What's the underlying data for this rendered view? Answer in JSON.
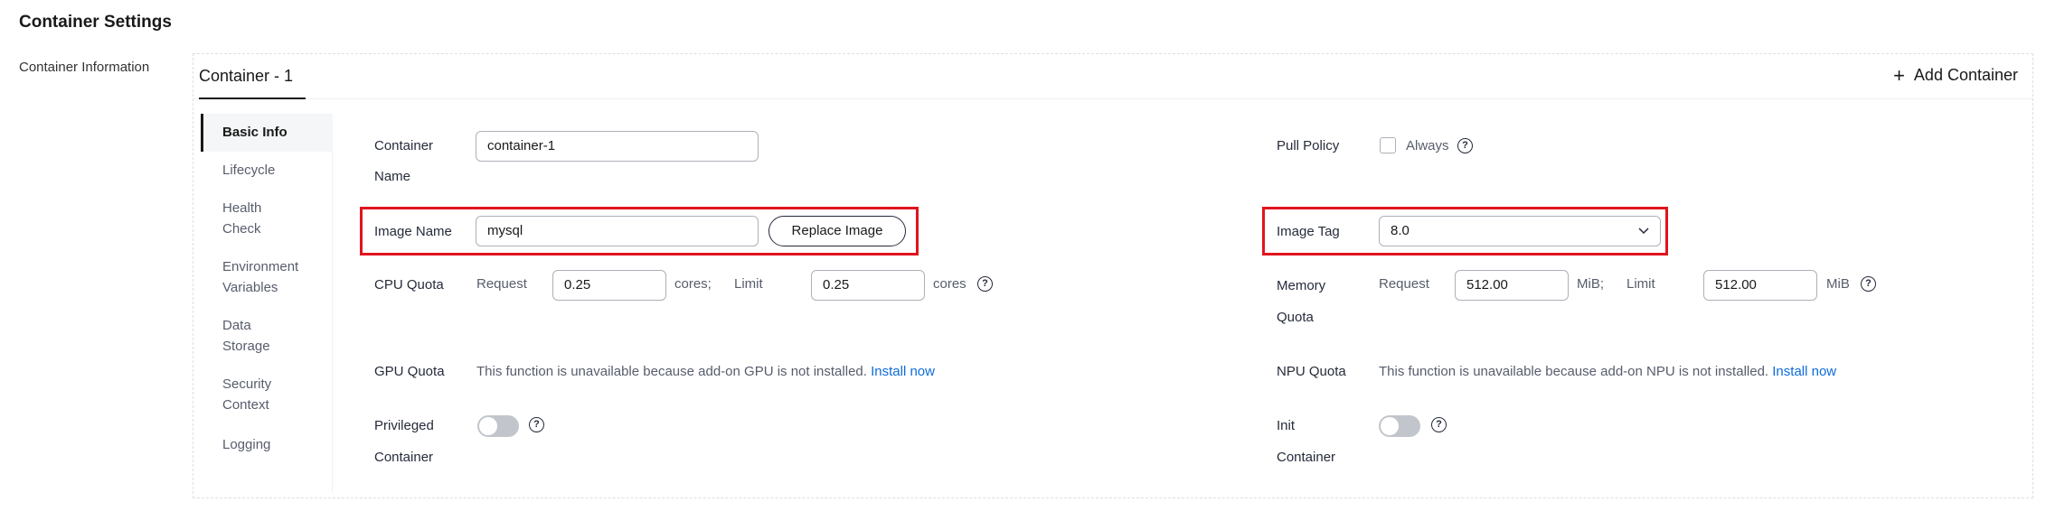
{
  "page": {
    "title": "Container Settings",
    "section_label": "Container Information"
  },
  "tabs": {
    "active": "Container - 1",
    "add_label": "Add Container"
  },
  "nav": {
    "items": [
      {
        "label": "Basic Info"
      },
      {
        "label": "Lifecycle"
      },
      {
        "label": "Health Check"
      },
      {
        "label": "Environment Variables"
      },
      {
        "label": "Data Storage"
      },
      {
        "label": "Security Context"
      },
      {
        "label": "Logging"
      }
    ]
  },
  "form": {
    "container_name": {
      "label_line1": "Container",
      "label_line2": "Name",
      "value": "container-1"
    },
    "pull_policy": {
      "label": "Pull Policy",
      "option": "Always",
      "checked": false
    },
    "image_name": {
      "label": "Image Name",
      "value": "mysql",
      "button": "Replace Image"
    },
    "image_tag": {
      "label": "Image Tag",
      "value": "8.0"
    },
    "cpu_quota": {
      "label": "CPU Quota",
      "request_label": "Request",
      "request_value": "0.25",
      "request_unit": "cores;",
      "limit_label": "Limit",
      "limit_value": "0.25",
      "limit_unit": "cores"
    },
    "memory_quota": {
      "label_line1": "Memory",
      "label_line2": "Quota",
      "request_label": "Request",
      "request_value": "512.00",
      "request_unit": "MiB;",
      "limit_label": "Limit",
      "limit_value": "512.00",
      "limit_unit": "MiB"
    },
    "gpu_quota": {
      "label": "GPU Quota",
      "message": "This function is unavailable because add-on GPU is not installed.",
      "link": "Install now"
    },
    "npu_quota": {
      "label": "NPU Quota",
      "message": "This function is unavailable because add-on NPU is not installed.",
      "link": "Install now"
    },
    "privileged": {
      "label_line1": "Privileged",
      "label_line2": "Container",
      "enabled": false
    },
    "init_container": {
      "label_line1": "Init",
      "label_line2": "Container",
      "enabled": false
    }
  },
  "colors": {
    "highlight": "#e0141e",
    "link": "#0e6cd9"
  }
}
